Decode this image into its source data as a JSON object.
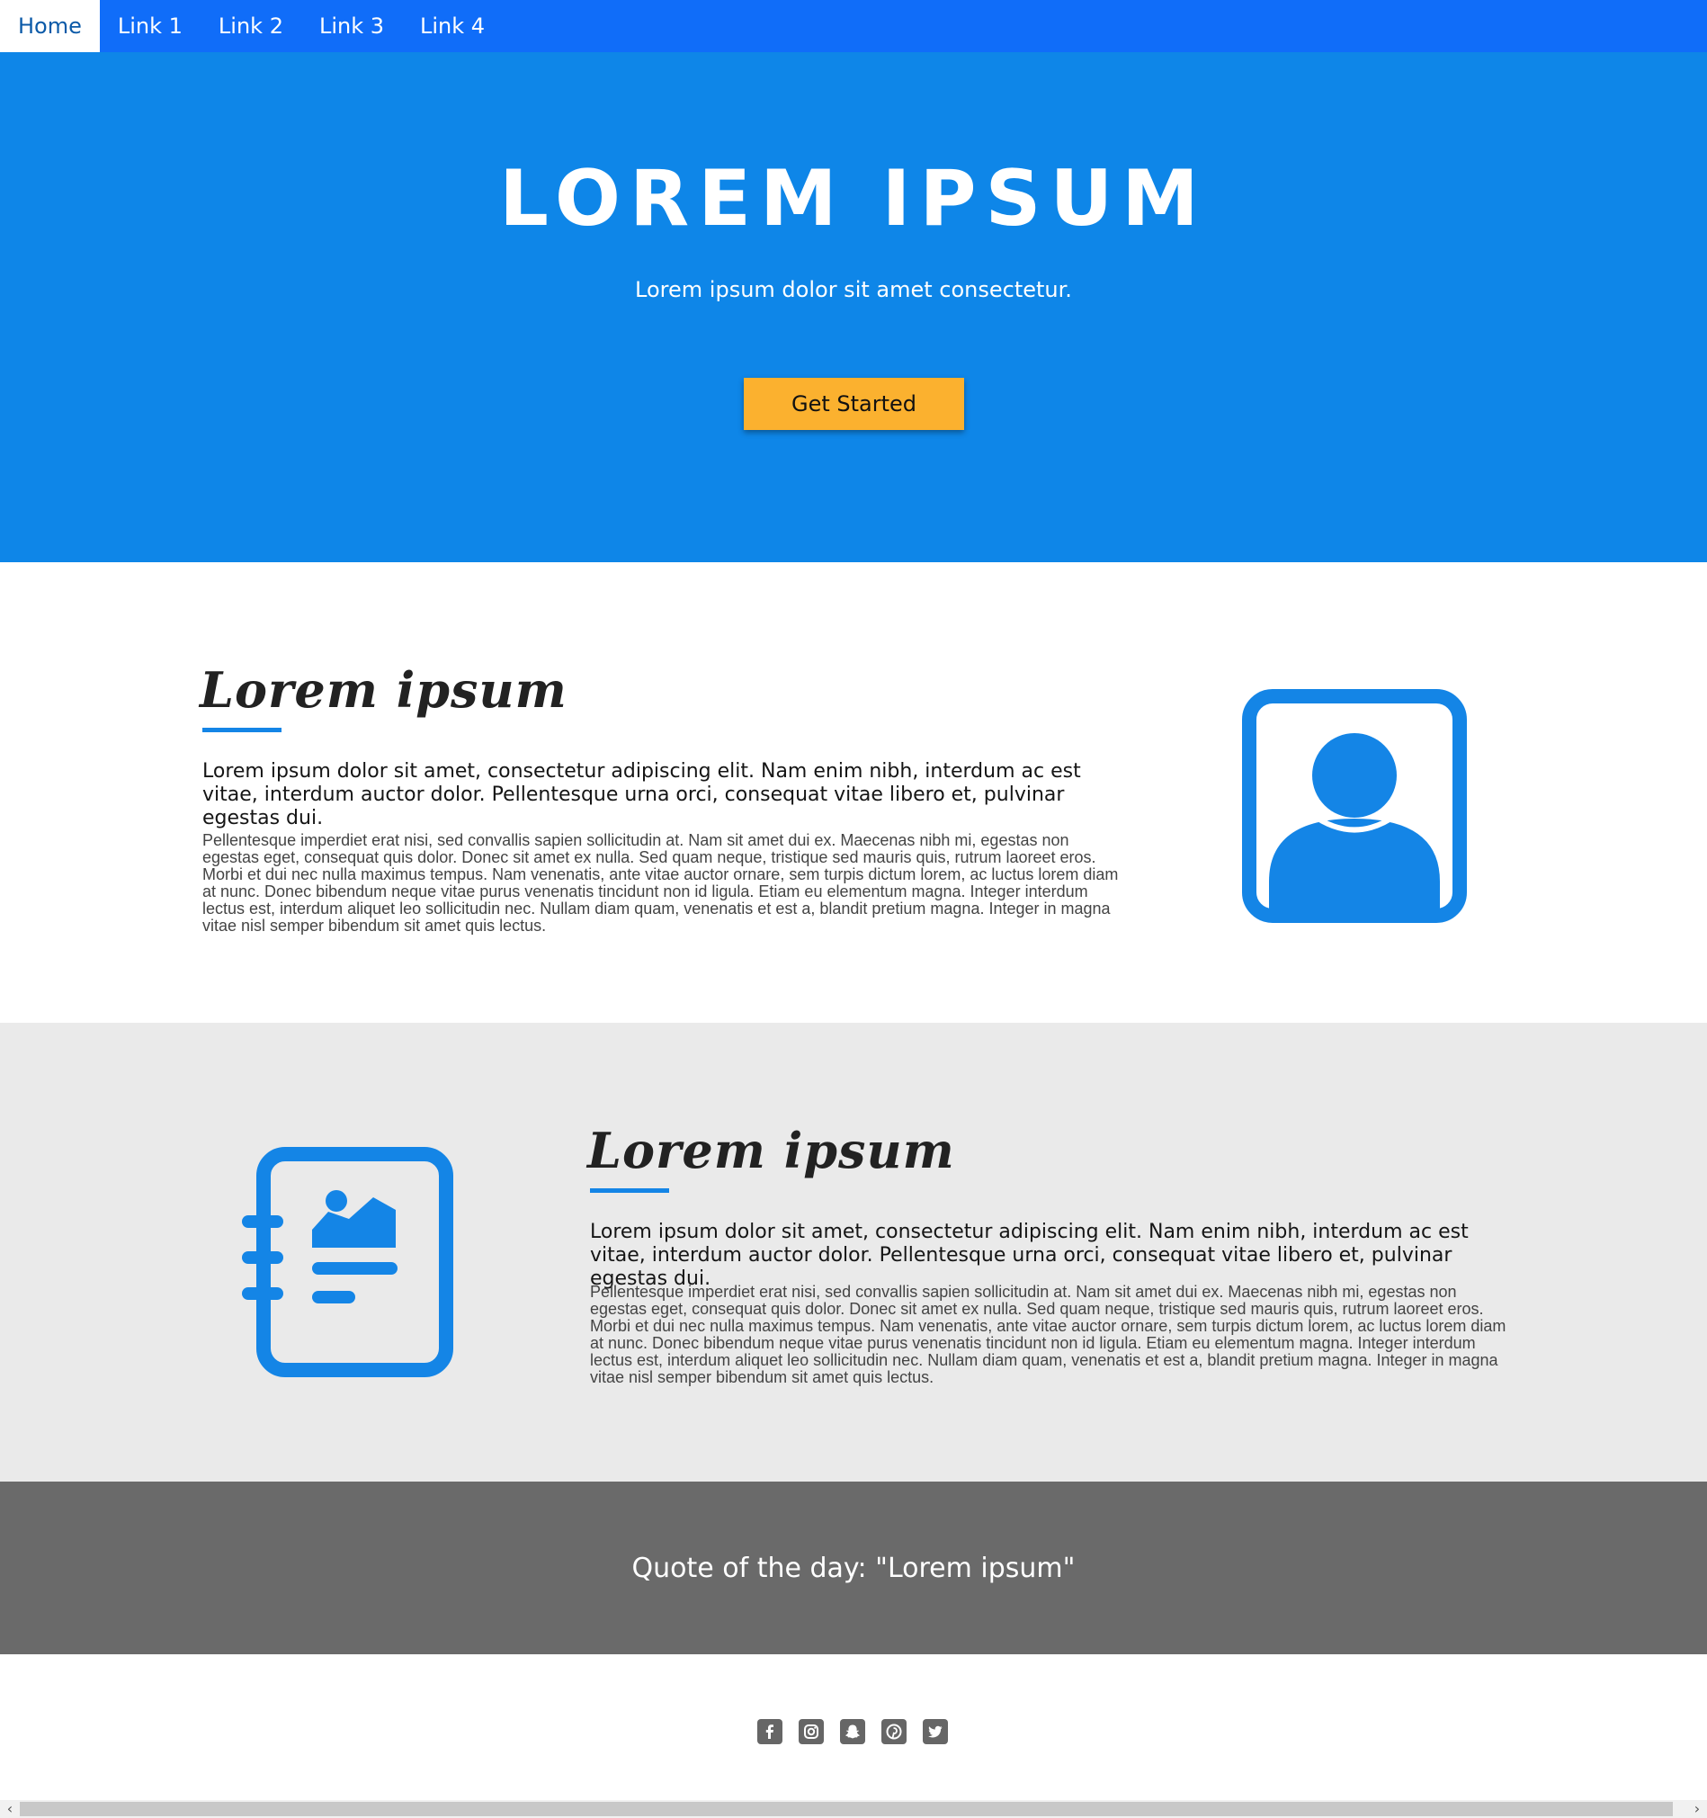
{
  "nav": {
    "items": [
      {
        "label": "Home",
        "active": true
      },
      {
        "label": "Link 1"
      },
      {
        "label": "Link 2"
      },
      {
        "label": "Link 3"
      },
      {
        "label": "Link 4"
      }
    ]
  },
  "hero": {
    "title": "LOREM IPSUM",
    "subtitle": "Lorem ipsum dolor sit amet consectetur.",
    "cta_label": "Get Started"
  },
  "section1": {
    "title": "Lorem ipsum",
    "lead": "Lorem ipsum dolor sit amet, consectetur adipiscing elit. Nam enim nibh, interdum ac est vitae, interdum auctor dolor. Pellentesque urna orci, consequat vitae libero et, pulvinar egestas dui.",
    "body": "Pellentesque imperdiet erat nisi, sed convallis sapien sollicitudin at. Nam sit amet dui ex. Maecenas nibh mi, egestas non egestas eget, consequat quis dolor. Donec sit amet ex nulla. Sed quam neque, tristique sed mauris quis, rutrum laoreet eros. Morbi et dui nec nulla maximus tempus. Nam venenatis, ante vitae auctor ornare, sem turpis dictum lorem, ac luctus lorem diam at nunc. Donec bibendum neque vitae purus venenatis tincidunt non id ligula. Etiam eu elementum magna. Integer interdum lectus est, interdum aliquet leo sollicitudin nec. Nullam diam quam, venenatis et est a, blandit pretium magna. Integer in magna vitae nisl semper bibendum sit amet quis lectus.",
    "icon": "profile-portrait-icon"
  },
  "section2": {
    "title": "Lorem ipsum",
    "lead": "Lorem ipsum dolor sit amet, consectetur adipiscing elit. Nam enim nibh, interdum ac est vitae, interdum auctor dolor. Pellentesque urna orci, consequat vitae libero et, pulvinar egestas dui.",
    "body": "Pellentesque imperdiet erat nisi, sed convallis sapien sollicitudin at. Nam sit amet dui ex. Maecenas nibh mi, egestas non egestas eget, consequat quis dolor. Donec sit amet ex nulla. Sed quam neque, tristique sed mauris quis, rutrum laoreet eros. Morbi et dui nec nulla maximus tempus. Nam venenatis, ante vitae auctor ornare, sem turpis dictum lorem, ac luctus lorem diam at nunc. Donec bibendum neque vitae purus venenatis tincidunt non id ligula. Etiam eu elementum magna. Integer interdum lectus est, interdum aliquet leo sollicitudin nec. Nullam diam quam, venenatis et est a, blandit pretium magna. Integer in magna vitae nisl semper bibendum sit amet quis lectus.",
    "icon": "notebook-image-icon"
  },
  "quote": {
    "text": "Quote of the day: \"Lorem ipsum\""
  },
  "footer": {
    "social_icons": [
      "facebook-icon",
      "instagram-icon",
      "snapchat-icon",
      "pinterest-icon",
      "twitter-icon"
    ]
  },
  "colors": {
    "nav_bg": "#106df9",
    "hero_bg": "#0e86e8",
    "cta_bg": "#fbb12f",
    "accent": "#1485e6",
    "section2_bg": "#eaeaea",
    "quote_bg": "#6a6a6a",
    "social_icon": "#666666"
  }
}
